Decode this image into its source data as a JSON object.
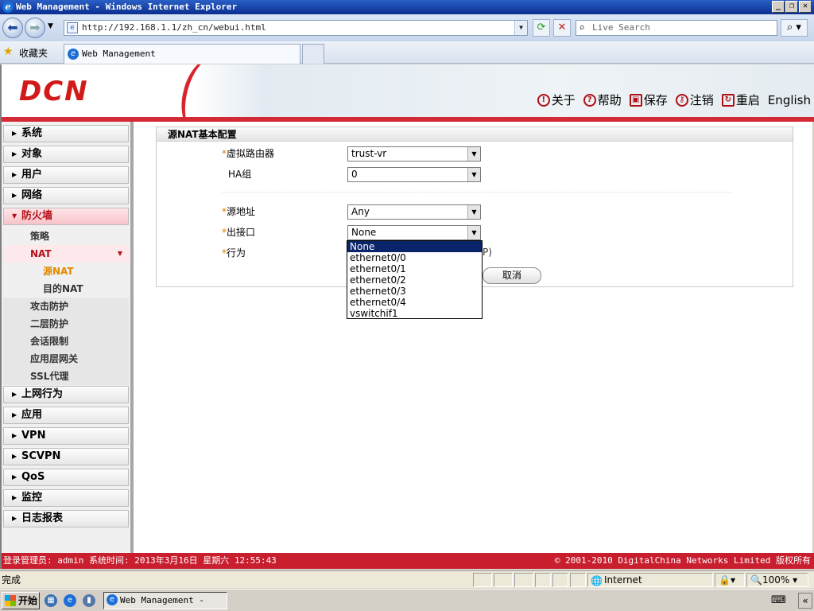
{
  "window": {
    "title": "Web Management - Windows Internet Explorer"
  },
  "browser": {
    "address": "http://192.168.1.1/zh_cn/webui.html",
    "search_placeholder": "Live Search",
    "favorites_label": "收藏夹",
    "tab_title": "Web Management"
  },
  "header": {
    "logo": "DCN",
    "links": [
      "关于",
      "帮助",
      "保存",
      "注销",
      "重启",
      "English"
    ]
  },
  "sidebar": {
    "main": [
      "系统",
      "对象",
      "用户",
      "网络",
      "防火墙"
    ],
    "firewall_sub": {
      "policy": "策略",
      "nat": "NAT"
    },
    "nat_sub": [
      "源NAT",
      "目的NAT"
    ],
    "firewall_more": [
      "攻击防护",
      "二层防护",
      "会话限制",
      "应用层网关",
      "SSL代理"
    ],
    "main_after": [
      "上网行为",
      "应用",
      "VPN",
      "SCVPN",
      "QoS",
      "监控",
      "日志报表"
    ]
  },
  "panel": {
    "title": "源NAT基本配置",
    "fields": {
      "vr": {
        "label": "虚拟路由器",
        "value": "trust-vr"
      },
      "ha": {
        "label": "HA组",
        "value": "0"
      },
      "src": {
        "label": "源地址",
        "value": "Any"
      },
      "egress": {
        "label": "出接口",
        "value": "None"
      },
      "action": {
        "label": "行为"
      }
    },
    "partial_text": "P)",
    "cancel": "取消",
    "dropdown_options": [
      "None",
      "ethernet0/0",
      "ethernet0/1",
      "ethernet0/2",
      "ethernet0/3",
      "ethernet0/4",
      "vswitchif1"
    ]
  },
  "footer": {
    "left": "登录管理员: admin 系统时间: 2013年3月16日 星期六 12:55:43",
    "right": "© 2001-2010 DigitalChina Networks Limited 版权所有"
  },
  "statusbar": {
    "status": "完成",
    "zone": "Internet",
    "zoom": "100%"
  },
  "taskbar": {
    "start": "开始",
    "item": "Web Management - Wi..."
  }
}
